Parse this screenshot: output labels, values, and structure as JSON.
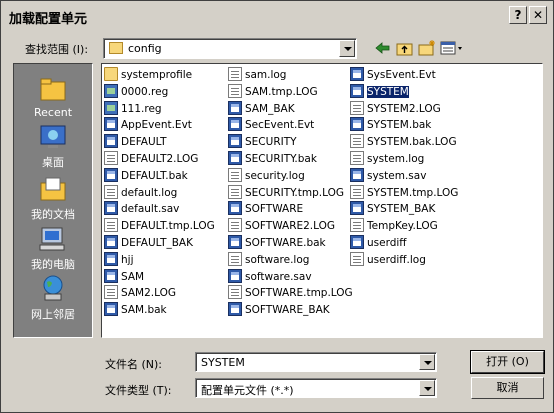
{
  "window": {
    "title": "加载配置单元",
    "help_label": "?",
    "close_label": "✕"
  },
  "look_in": {
    "label": "查找范围 (I):",
    "value": "config"
  },
  "places": [
    {
      "label": "Recent",
      "icon": "recent-folder-icon"
    },
    {
      "label": "桌面",
      "icon": "desktop-icon"
    },
    {
      "label": "我的文档",
      "icon": "my-documents-icon"
    },
    {
      "label": "我的电脑",
      "icon": "my-computer-icon"
    },
    {
      "label": "网上邻居",
      "icon": "network-places-icon"
    }
  ],
  "files": [
    {
      "name": "systemprofile",
      "icon": "folder"
    },
    {
      "name": "0000.reg",
      "icon": "reg"
    },
    {
      "name": "111.reg",
      "icon": "reg"
    },
    {
      "name": "AppEvent.Evt",
      "icon": "hive"
    },
    {
      "name": "DEFAULT",
      "icon": "hive"
    },
    {
      "name": "DEFAULT2.LOG",
      "icon": "doc"
    },
    {
      "name": "DEFAULT.bak",
      "icon": "hive"
    },
    {
      "name": "default.log",
      "icon": "doc"
    },
    {
      "name": "default.sav",
      "icon": "hive"
    },
    {
      "name": "DEFAULT.tmp.LOG",
      "icon": "doc"
    },
    {
      "name": "DEFAULT_BAK",
      "icon": "hive"
    },
    {
      "name": "hjj",
      "icon": "hive"
    },
    {
      "name": "SAM",
      "icon": "hive"
    },
    {
      "name": "SAM2.LOG",
      "icon": "doc"
    },
    {
      "name": "SAM.bak",
      "icon": "hive"
    },
    {
      "name": "sam.log",
      "icon": "doc"
    },
    {
      "name": "SAM.tmp.LOG",
      "icon": "doc"
    },
    {
      "name": "SAM_BAK",
      "icon": "hive"
    },
    {
      "name": "SecEvent.Evt",
      "icon": "hive"
    },
    {
      "name": "SECURITY",
      "icon": "hive"
    },
    {
      "name": "SECURITY.bak",
      "icon": "hive"
    },
    {
      "name": "security.log",
      "icon": "doc"
    },
    {
      "name": "SECURITY.tmp.LOG",
      "icon": "doc"
    },
    {
      "name": "SOFTWARE",
      "icon": "hive"
    },
    {
      "name": "SOFTWARE2.LOG",
      "icon": "doc"
    },
    {
      "name": "SOFTWARE.bak",
      "icon": "hive"
    },
    {
      "name": "software.log",
      "icon": "doc"
    },
    {
      "name": "software.sav",
      "icon": "hive"
    },
    {
      "name": "SOFTWARE.tmp.LOG",
      "icon": "doc"
    },
    {
      "name": "SOFTWARE_BAK",
      "icon": "hive"
    },
    {
      "name": "SysEvent.Evt",
      "icon": "hive"
    },
    {
      "name": "SYSTEM",
      "icon": "hive",
      "selected": true
    },
    {
      "name": "SYSTEM2.LOG",
      "icon": "doc"
    },
    {
      "name": "SYSTEM.bak",
      "icon": "hive"
    },
    {
      "name": "SYSTEM.bak.LOG",
      "icon": "doc"
    },
    {
      "name": "system.log",
      "icon": "doc"
    },
    {
      "name": "system.sav",
      "icon": "hive"
    },
    {
      "name": "SYSTEM.tmp.LOG",
      "icon": "doc"
    },
    {
      "name": "SYSTEM_BAK",
      "icon": "hive"
    },
    {
      "name": "TempKey.LOG",
      "icon": "doc"
    },
    {
      "name": "userdiff",
      "icon": "hive"
    },
    {
      "name": "userdiff.log",
      "icon": "doc"
    }
  ],
  "filename": {
    "label": "文件名 (N):",
    "value": "SYSTEM"
  },
  "filetype": {
    "label": "文件类型 (T):",
    "value": "配置单元文件 (*.*)"
  },
  "buttons": {
    "open": "打开 (O)",
    "cancel": "取消"
  }
}
